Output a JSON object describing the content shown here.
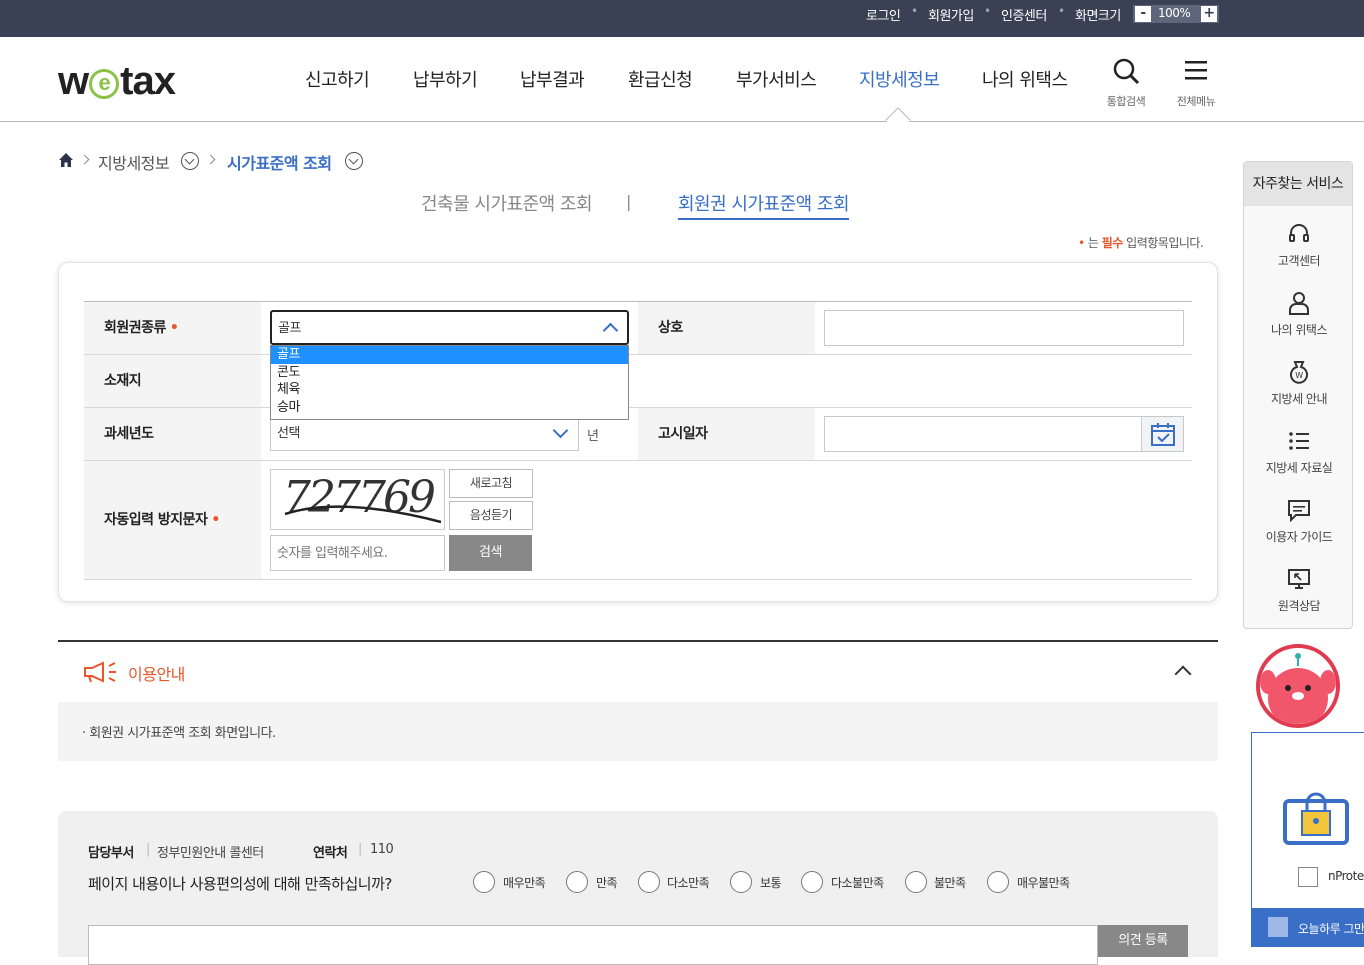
{
  "utility_bar": {
    "login": "로그인",
    "join": "회원가입",
    "cert": "인증센터",
    "screen_size": "화면크기",
    "zoom_minus": "-",
    "zoom_value": "100%",
    "zoom_plus": "+"
  },
  "header": {
    "logo_left": "w",
    "logo_e": "e",
    "logo_right": "tax",
    "nav": [
      "신고하기",
      "납부하기",
      "납부결과",
      "환급신청",
      "부가서비스",
      "지방세정보",
      "나의 위택스"
    ],
    "search_caption": "통합검색",
    "menu_caption": "전체메뉴"
  },
  "breadcrumb": {
    "level1": "지방세정보",
    "level2": "시가표준액 조회"
  },
  "tabs": {
    "building": "건축물 시가표준액 조회",
    "divider": "|",
    "membership": "회원권 시가표준액 조회"
  },
  "required_note": {
    "bullet": "•",
    "pre": "는 ",
    "word": "필수",
    "post": " 입력항목입니다."
  },
  "form": {
    "membership_type_label": "회원권종류",
    "membership_type_value": "골프",
    "membership_type_options": [
      "골프",
      "콘도",
      "체육",
      "승마"
    ],
    "company_label": "상호",
    "location_label": "소재지",
    "tax_year_label": "과세년도",
    "tax_year_value": "선택",
    "tax_year_unit": "년",
    "notice_date_label": "고시일자",
    "captcha_label": "자동입력 방지문자",
    "captcha_text": "727769",
    "refresh_button": "새로고침",
    "audio_button": "음성듣기",
    "captcha_placeholder": "숫자를 입력해주세요.",
    "search_button": "검색",
    "required_mark": "•"
  },
  "guide": {
    "title": "이용안내",
    "text": "· 회원권 시가표준액 조회 화면입니다."
  },
  "survey": {
    "dept_label": "담당부서",
    "dept_value": "정부민원안내 콜센터",
    "contact_label": "연락처",
    "contact_value": "110",
    "question": "페이지 내용이나 사용편의성에 대해 만족하십니까?",
    "options": [
      "매우만족",
      "만족",
      "다소만족",
      "보통",
      "다소불만족",
      "불만족",
      "매우불만족"
    ],
    "submit_button": "의견 등록"
  },
  "quick_menu": {
    "title": "자주찾는 서비스",
    "items": [
      "고객센터",
      "나의 위택스",
      "지방세 안내",
      "지방세 자료실",
      "이용자 가이드",
      "원격상담"
    ]
  },
  "popup": {
    "checkbox_label": "nProte",
    "bottom_text": "오늘하루 그만"
  },
  "colors": {
    "top_bar": "#3b4155",
    "accent_blue": "#3a6fc7",
    "required_orange": "#e8562a",
    "logo_green": "#8bc34a",
    "search_button": "#888888"
  }
}
